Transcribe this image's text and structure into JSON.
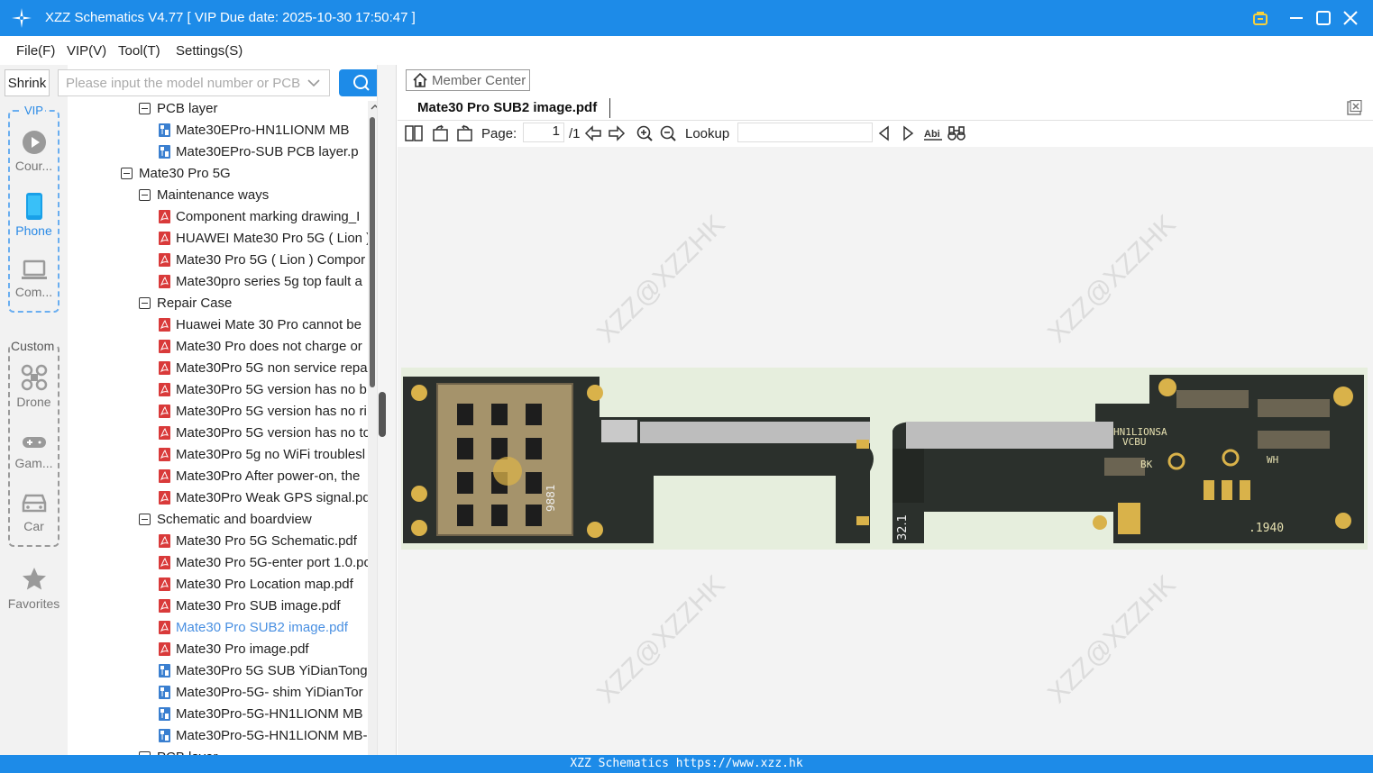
{
  "app": {
    "title": "XZZ Schematics V4.77 [ VIP Due date: 2025-10-30 17:50:47 ]"
  },
  "menu": [
    "File(F)",
    "VIP(V)",
    "Tool(T)",
    "Settings(S)"
  ],
  "sidebar": {
    "shrink_label": "Shrink",
    "vip_label": "VIP",
    "custom_label": "Custom",
    "vip_items": [
      {
        "label": "Cour...",
        "icon": "play-icon"
      },
      {
        "label": "Phone",
        "icon": "phone-icon"
      },
      {
        "label": "Com...",
        "icon": "laptop-icon"
      }
    ],
    "custom_items": [
      {
        "label": "Drone",
        "icon": "drone-icon"
      },
      {
        "label": "Gam...",
        "icon": "gamepad-icon"
      },
      {
        "label": "Car",
        "icon": "car-icon"
      }
    ],
    "favorites_label": "Favorites"
  },
  "search": {
    "placeholder": "Please input the model number or PCB"
  },
  "tree": [
    {
      "label": "PCB layer",
      "type": "folder",
      "level": 2
    },
    {
      "label": "Mate30EPro-HN1LIONM MB",
      "type": "pcb",
      "level": 3
    },
    {
      "label": "Mate30EPro-SUB PCB layer.p",
      "type": "pcb",
      "level": 3
    },
    {
      "label": "Mate30 Pro 5G",
      "type": "folder",
      "level": 1
    },
    {
      "label": "Maintenance ways",
      "type": "folder",
      "level": 2
    },
    {
      "label": "Component marking drawing_I",
      "type": "pdf",
      "level": 3
    },
    {
      "label": "HUAWEI Mate30 Pro 5G ( Lion )",
      "type": "pdf",
      "level": 3
    },
    {
      "label": "Mate30 Pro 5G ( Lion ) Compor",
      "type": "pdf",
      "level": 3
    },
    {
      "label": "Mate30pro series 5g top fault a",
      "type": "pdf",
      "level": 3
    },
    {
      "label": "Repair Case",
      "type": "folder",
      "level": 2
    },
    {
      "label": "Huawei Mate 30 Pro cannot be",
      "type": "pdf",
      "level": 3
    },
    {
      "label": "Mate30 Pro does not charge or",
      "type": "pdf",
      "level": 3
    },
    {
      "label": "Mate30Pro 5G non service repa",
      "type": "pdf",
      "level": 3
    },
    {
      "label": "Mate30Pro 5G version has no b",
      "type": "pdf",
      "level": 3
    },
    {
      "label": "Mate30Pro 5G version has no ri",
      "type": "pdf",
      "level": 3
    },
    {
      "label": "Mate30Pro 5G version has no to",
      "type": "pdf",
      "level": 3
    },
    {
      "label": "Mate30Pro 5g no WiFi troublesl",
      "type": "pdf",
      "level": 3
    },
    {
      "label": "Mate30Pro After power-on, the",
      "type": "pdf",
      "level": 3
    },
    {
      "label": "Mate30Pro Weak GPS signal.pd",
      "type": "pdf",
      "level": 3
    },
    {
      "label": "Schematic and boardview",
      "type": "folder",
      "level": 2
    },
    {
      "label": "Mate30 Pro 5G Schematic.pdf",
      "type": "pdf",
      "level": 3
    },
    {
      "label": "Mate30 Pro 5G-enter port 1.0.pc",
      "type": "pdf",
      "level": 3
    },
    {
      "label": "Mate30 Pro Location map.pdf",
      "type": "pdf",
      "level": 3
    },
    {
      "label": "Mate30 Pro SUB image.pdf",
      "type": "pdf",
      "level": 3
    },
    {
      "label": "Mate30 Pro SUB2 image.pdf",
      "type": "pdf",
      "level": 3,
      "selected": true
    },
    {
      "label": "Mate30 Pro image.pdf",
      "type": "pdf",
      "level": 3
    },
    {
      "label": "Mate30Pro 5G SUB YiDianTong",
      "type": "pcb",
      "level": 3
    },
    {
      "label": "Mate30Pro-5G- shim YiDianTor",
      "type": "pcb",
      "level": 3
    },
    {
      "label": "Mate30Pro-5G-HN1LIONM MB",
      "type": "pcb",
      "level": 3
    },
    {
      "label": "Mate30Pro-5G-HN1LIONM MB-",
      "type": "pcb",
      "level": 3
    },
    {
      "label": "PCB layer",
      "type": "folder",
      "level": 2
    }
  ],
  "viewer": {
    "member_center": "Member Center",
    "tab_title": "Mate30 Pro SUB2 image.pdf",
    "page_label": "Page:",
    "page_value": "1",
    "page_total": "/1",
    "lookup_label": "Lookup",
    "watermark": "XZZ@XZZHK",
    "board_labels": [
      "9881",
      "32.1",
      "HN1LIONSA",
      "VCBU",
      "BK",
      "WH",
      ".1940"
    ]
  },
  "status": {
    "text": "XZZ Schematics https://www.xzz.hk"
  },
  "colors": {
    "accent": "#1d8be8",
    "selected": "#4a90e2",
    "pdf_icon": "#d93a3a",
    "pcb_icon": "#3a7fd0"
  }
}
